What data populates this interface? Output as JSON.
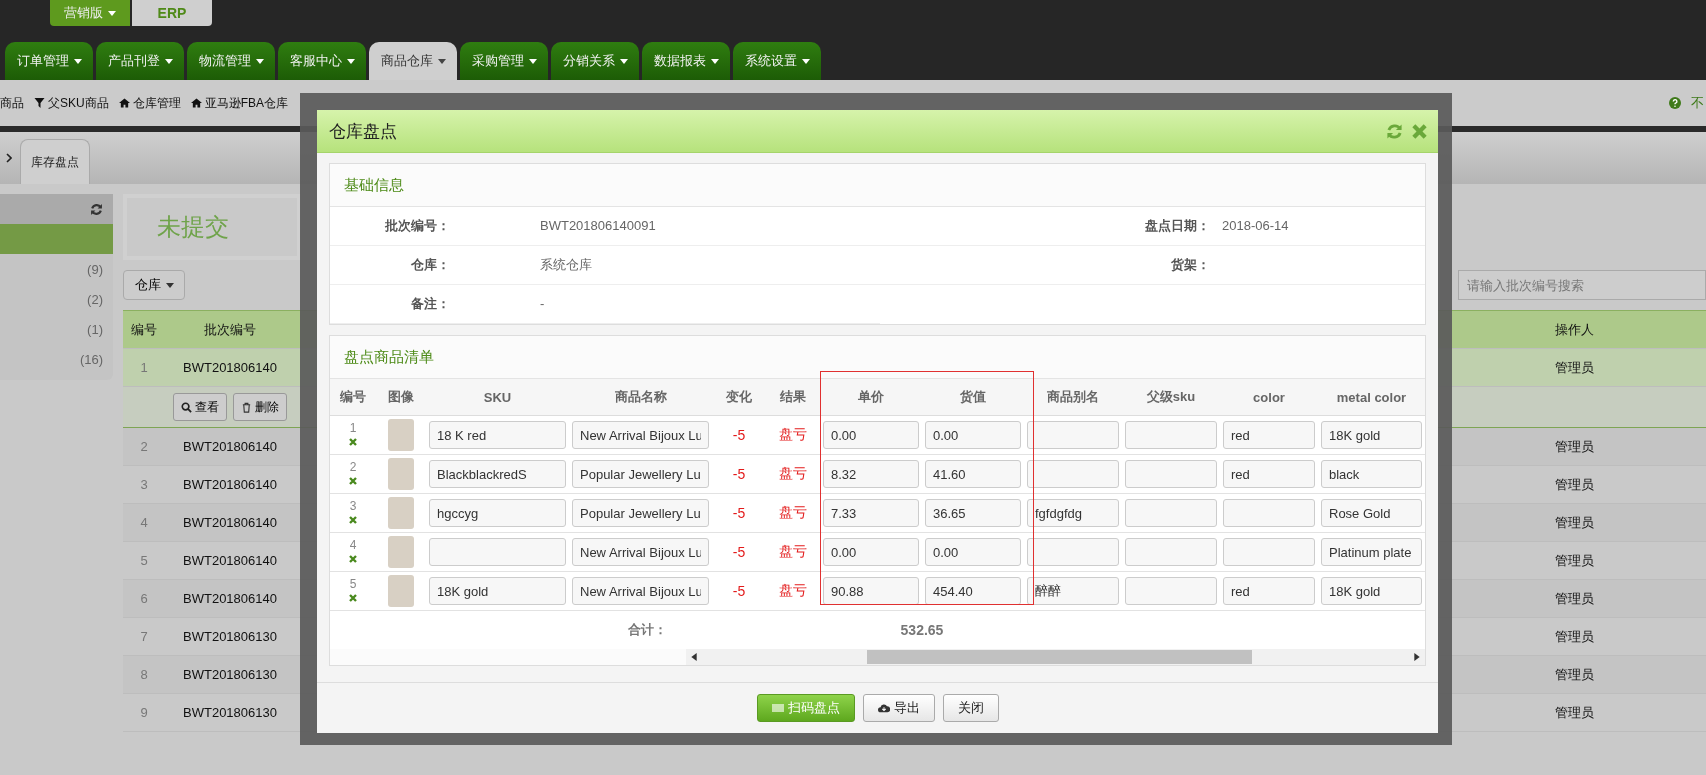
{
  "brand": {
    "edition": "营销版",
    "erp": "ERP"
  },
  "nav_tabs": [
    {
      "label": "订单管理",
      "selected": false
    },
    {
      "label": "产品刊登",
      "selected": false
    },
    {
      "label": "物流管理",
      "selected": false
    },
    {
      "label": "客服中心",
      "selected": false
    },
    {
      "label": "商品仓库",
      "selected": true
    },
    {
      "label": "采购管理",
      "selected": false
    },
    {
      "label": "分销关系",
      "selected": false
    },
    {
      "label": "数据报表",
      "selected": false
    },
    {
      "label": "系统设置",
      "selected": false
    }
  ],
  "sub_nav": [
    {
      "label": "商品",
      "kind": "plain"
    },
    {
      "label": "父SKU商品",
      "kind": "filter"
    },
    {
      "label": "仓库管理",
      "kind": "home"
    },
    {
      "label": "亚马逊FBA仓库",
      "kind": "home"
    }
  ],
  "help": {
    "label": "不"
  },
  "page_tab": {
    "label": "库存盘点"
  },
  "sidebar": {
    "items": [
      {
        "selected": true
      },
      {
        "count": "(9)",
        "selected": false
      },
      {
        "count": "(2)",
        "selected": false
      },
      {
        "count": "(1)",
        "selected": false
      },
      {
        "count": "(16)",
        "selected": false
      }
    ]
  },
  "status_title": "未提交",
  "warehouse_filter": "仓库",
  "search": {
    "placeholder": "请输入批次编号搜索"
  },
  "table": {
    "columns": [
      "编号",
      "批次编号",
      "操作人"
    ],
    "rows": [
      {
        "number": "1",
        "batch": "BWT201806140",
        "operator": "管理员",
        "selected": true,
        "actions": [
          "查看",
          "删除"
        ]
      },
      {
        "number": "2",
        "batch": "BWT201806140",
        "operator": "管理员",
        "selected": false
      },
      {
        "number": "3",
        "batch": "BWT201806140",
        "operator": "管理员",
        "selected": false
      },
      {
        "number": "4",
        "batch": "BWT201806140",
        "operator": "管理员",
        "selected": false
      },
      {
        "number": "5",
        "batch": "BWT201806140",
        "operator": "管理员",
        "selected": false
      },
      {
        "number": "6",
        "batch": "BWT201806140",
        "operator": "管理员",
        "selected": false
      },
      {
        "number": "7",
        "batch": "BWT201806130",
        "operator": "管理员",
        "selected": false
      },
      {
        "number": "8",
        "batch": "BWT201806130",
        "operator": "管理员",
        "selected": false
      },
      {
        "number": "9",
        "batch": "BWT201806130",
        "operator": "管理员",
        "selected": false
      }
    ]
  },
  "dialog": {
    "title": "仓库盘点",
    "basic_info": {
      "title": "基础信息",
      "fields": [
        {
          "label": "批次编号：",
          "value": "BWT201806140091"
        },
        {
          "label": "盘点日期：",
          "value": "2018-06-14"
        },
        {
          "label": "仓库：",
          "value": "系统仓库"
        },
        {
          "label": "货架："
        },
        {
          "label": "备注：",
          "value": "-"
        }
      ]
    },
    "items": {
      "title": "盘点商品清单",
      "columns": [
        "编号",
        "图像",
        "SKU",
        "商品名称",
        "变化",
        "结果",
        "单价",
        "货值",
        "商品别名",
        "父级sku",
        "color",
        "metal color"
      ],
      "rows": [
        {
          "number": "1",
          "sku": "18 K red",
          "name": "New Arrival Bijoux Lu",
          "change": "-5",
          "result": "盘亏",
          "unit_price": "0.00",
          "value": "0.00",
          "color_option": "red",
          "metal_color": "18K gold"
        },
        {
          "number": "2",
          "sku": "BlackblackredS",
          "name": "Popular Jewellery Lu",
          "change": "-5",
          "result": "盘亏",
          "unit_price": "8.32",
          "value": "41.60",
          "color_option": "red",
          "metal_color": "black"
        },
        {
          "number": "3",
          "sku": "hgccyg",
          "name": "Popular Jewellery Lu",
          "change": "-5",
          "result": "盘亏",
          "unit_price": "7.33",
          "value": "36.65",
          "alias": "fgfdgfdg",
          "metal_color": "Rose Gold"
        },
        {
          "number": "4",
          "name": "New Arrival Bijoux Lu",
          "change": "-5",
          "result": "盘亏",
          "unit_price": "0.00",
          "value": "0.00",
          "metal_color": "Platinum plate"
        },
        {
          "number": "5",
          "sku": "18K gold",
          "name": "New Arrival Bijoux Lu",
          "change": "-5",
          "result": "盘亏",
          "unit_price": "90.88",
          "value": "454.40",
          "alias": "醉醉",
          "color_option": "red",
          "metal_color": "18K gold"
        }
      ],
      "total_label": "合计：",
      "total": "532.65"
    },
    "buttons": [
      {
        "label": "扫码盘点",
        "kind": "primary"
      },
      {
        "label": "导出",
        "kind": "export"
      },
      {
        "label": "关闭",
        "kind": "plain"
      }
    ]
  }
}
